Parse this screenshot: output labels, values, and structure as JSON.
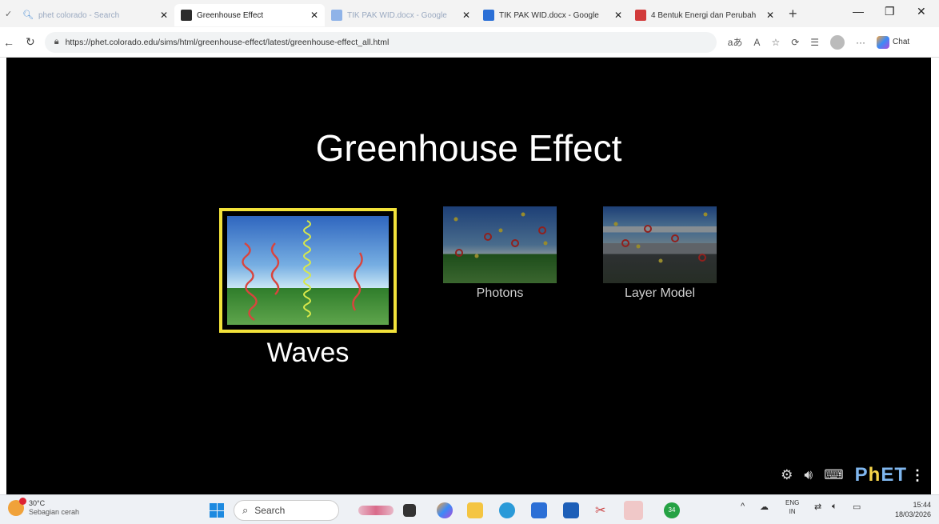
{
  "browser": {
    "tabs": [
      {
        "label": "phet colorado - Search",
        "dim": true,
        "color": "#4c8fd6"
      },
      {
        "label": "Greenhouse Effect",
        "dim": false,
        "color": "#2b2b2b",
        "active": true
      },
      {
        "label": "TIK PAK WID.docx - Google",
        "dim": true,
        "color": "#4c8fd6"
      },
      {
        "label": "TIK PAK WID.docx - Google",
        "dim": false,
        "color": "#2b6fd6"
      },
      {
        "label": "4 Bentuk Energi dan Perubah",
        "dim": false,
        "color": "#d23b3b"
      }
    ],
    "new_tab": "+",
    "url": "https://phet.colorado.edu/sims/html/greenhouse-effect/latest/greenhouse-effect_all.html",
    "copilot_label": "Chat"
  },
  "sim": {
    "title": "Greenhouse Effect",
    "screens": [
      {
        "label": "Waves",
        "selected": true
      },
      {
        "label": "Photons",
        "selected": false
      },
      {
        "label": "Layer Model",
        "selected": false
      }
    ],
    "logo": {
      "p": "P",
      "h": "h",
      "et": "ET"
    },
    "colors": {
      "selected_border": "#f2e23a",
      "sky_top": "#3a6fc2",
      "sky_bottom": "#bfe0f4",
      "ground": "#3f8a32"
    }
  },
  "taskbar": {
    "temperature": "30°C",
    "weather": "Sebagian cerah",
    "search_placeholder": "Search",
    "lang_top": "ENG",
    "lang_bottom": "IN",
    "time": "15:44",
    "date": "18/03/2026",
    "chat_badge": "34"
  }
}
